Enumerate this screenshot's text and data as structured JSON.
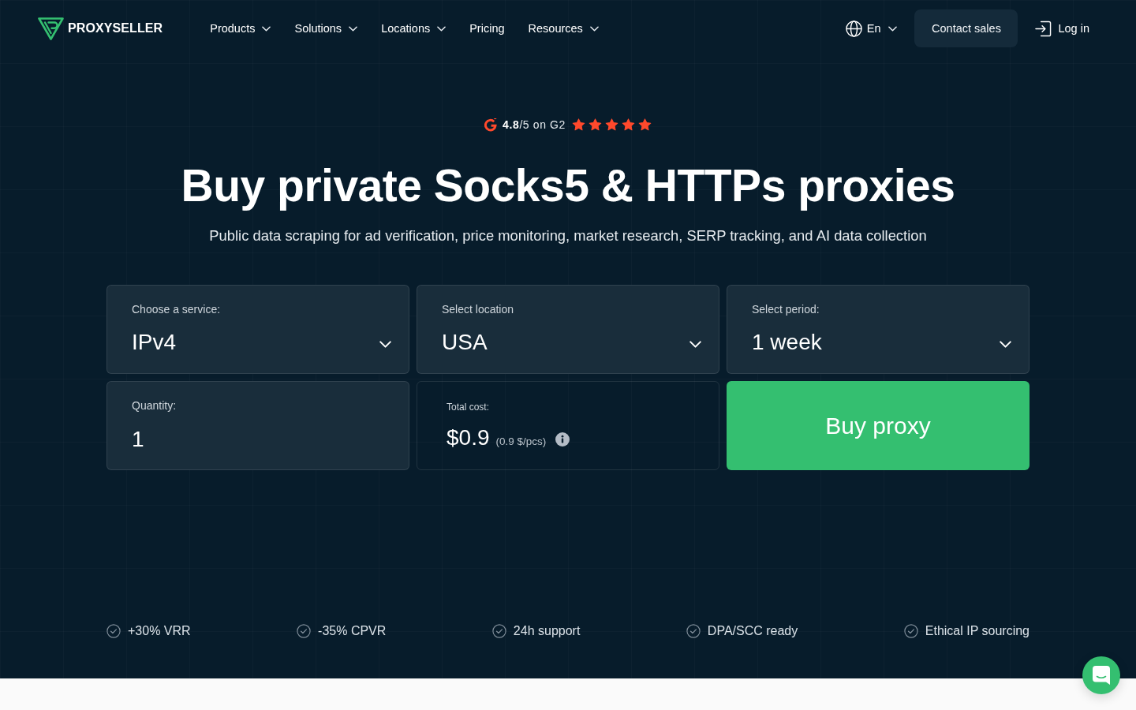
{
  "header": {
    "logo": "PROXYSELLER",
    "nav": [
      {
        "label": "Products",
        "kind": "dropdown"
      },
      {
        "label": "Solutions",
        "kind": "dropdown"
      },
      {
        "label": "Locations",
        "kind": "dropdown"
      },
      {
        "label": "Pricing",
        "kind": "link"
      },
      {
        "label": "Resources",
        "kind": "dropdown"
      }
    ],
    "language": "En",
    "contact_button": "Contact sales",
    "login": "Log in"
  },
  "rating": {
    "text": "**4.8**/5 on G2",
    "stars": 5
  },
  "hero": {
    "title": "Buy private Socks5 & HTTPs proxies",
    "subtitle": "Public data scraping for ad verification, price monitoring, market research, SERP tracking, and AI data collection"
  },
  "order_form": {
    "selects": [
      {
        "label": "Choose a service:",
        "value": "IPv4"
      },
      {
        "label": "Select location",
        "value": "USA"
      },
      {
        "label": "Select period:",
        "value": "1 week"
      }
    ],
    "quantity": {
      "label": "Quantity:",
      "value": "1"
    },
    "total": {
      "label": "Total cost:",
      "value": "$0.9",
      "unit_price": "(0.9 $/pcs)"
    },
    "buy_button": "Buy proxy"
  },
  "features": [
    "+30% VRR",
    "-35% CPVR",
    "24h support",
    "DPA/SCC ready",
    "Ethical IP sourcing"
  ]
}
